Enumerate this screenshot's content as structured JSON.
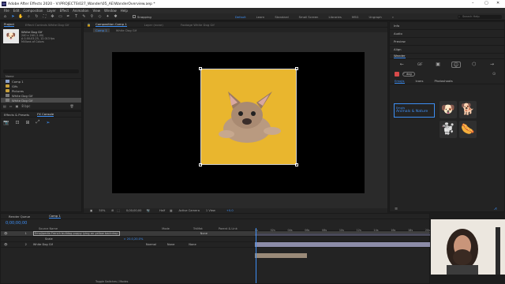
{
  "app": {
    "title": "Adobe After Effects 2020 - V:\\PROJECTS\\027_Wander\\05_AE\\WanderOverview.aep *",
    "window_buttons": [
      "–",
      "▢",
      "✕"
    ]
  },
  "menu": [
    "File",
    "Edit",
    "Composition",
    "Layer",
    "Effect",
    "Animation",
    "View",
    "Window",
    "Help"
  ],
  "toolbar": {
    "snapping_label": "Snapping",
    "workspaces": [
      "Default",
      "Learn",
      "Standard",
      "Small Screen",
      "Libraries",
      "MSG",
      "Ungraph"
    ],
    "active_workspace": "Default",
    "search_placeholder": "Search Help"
  },
  "project_panel": {
    "tabs": [
      "Project",
      "Effect Controls White Dog Gif"
    ],
    "preview_name": "White Dog Gif",
    "preview_info": [
      "240 x 240 (1.00)",
      "Δ 0;00;03;25, 12.013 fps",
      "Millions of Colors"
    ],
    "search_placeholder": "",
    "column_name": "Name",
    "items": [
      {
        "name": "Comp 1",
        "type": "comp",
        "selected": false
      },
      {
        "name": "Gifs",
        "type": "folder",
        "selected": false
      },
      {
        "name": "Pictures",
        "type": "folder",
        "selected": false
      },
      {
        "name": "White Dog Gif",
        "type": "footage",
        "selected": false
      },
      {
        "name": "White Dog Gif",
        "type": "footage",
        "selected": true
      }
    ],
    "bpc": "8 bpc"
  },
  "effects_panel": {
    "tabs": [
      "Effects & Presets",
      "FX Console"
    ]
  },
  "viewer": {
    "tabs": [
      "Composition Comp 1",
      "Layer (none)",
      "Footage White Dog Gif"
    ],
    "breadcrumb": [
      "Comp 1",
      "White Dog Gif"
    ],
    "zoom": "50%",
    "timecode": "0;00;00;00",
    "resolution": "Half",
    "camera": "Active Camera",
    "views": "1 View",
    "exposure": "+0.0"
  },
  "right_panel": {
    "top_items": [
      "Info",
      "Audio",
      "Preview",
      "Align"
    ],
    "wander_title": "Wander",
    "search_value": "dog",
    "tabs": [
      "Emojis",
      "Icons",
      "Photoshoots"
    ],
    "active_tab": "Emojis",
    "category_small": "Emojis",
    "category_main": "Animals & Nature",
    "emojis": [
      {
        "name": "dog-face-emoji",
        "glyph": "🐶"
      },
      {
        "name": "dog-emoji",
        "glyph": "🐕"
      },
      {
        "name": "poodle-emoji",
        "glyph": "🐩"
      },
      {
        "name": "hot-dog-emoji",
        "glyph": "🌭"
      }
    ]
  },
  "timeline": {
    "tabs": [
      "Render Queue",
      "Comp 1"
    ],
    "timecode": "0;00;00;00",
    "columns": [
      "Source Name",
      "Mode",
      "TrkMat",
      "Parent & Link"
    ],
    "layers": [
      {
        "index": "1",
        "name": "Emojipedia French bulldog puppy lying on yellow backdrop",
        "mode": "",
        "trkmat": "",
        "parent": "None"
      },
      {
        "index": "",
        "name": "Scale",
        "mode": "",
        "trkmat": "",
        "parent": ""
      },
      {
        "index": "2",
        "name": "White Dog Gif",
        "mode": "Normal",
        "trkmat": "None",
        "parent": "None"
      }
    ],
    "scale_value": "∞ 20.0,20.0%",
    "ruler": [
      "0s",
      "02s",
      "04s",
      "06s",
      "08s",
      "10s",
      "12s",
      "14s",
      "16s",
      "18s",
      "20s",
      "22s"
    ],
    "toggle_label": "Toggle Switches / Modes"
  },
  "colors": {
    "accent": "#3d8ef3",
    "dog_bg": "#e9b62e",
    "layer_bar": "#8c8ca8",
    "layer_bar2": "#9a8a78"
  }
}
